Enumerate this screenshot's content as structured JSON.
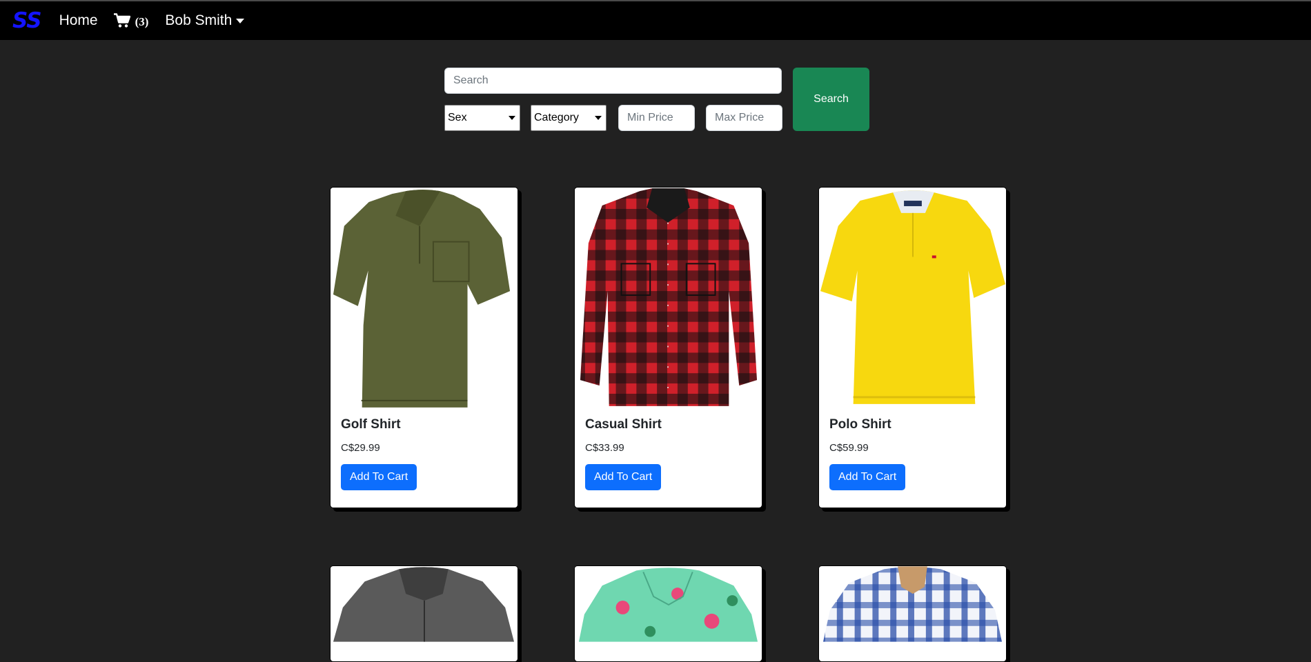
{
  "navbar": {
    "brand": "SS",
    "home_label": "Home",
    "cart_count": "(3)",
    "user_name": "Bob Smith"
  },
  "search": {
    "placeholder": "Search",
    "button_label": "Search",
    "sex_selected": "Sex",
    "category_selected": "Category",
    "min_price_placeholder": "Min Price",
    "max_price_placeholder": "Max Price"
  },
  "products": [
    {
      "title": "Golf Shirt",
      "price": "C$29.99",
      "button_label": "Add To Cart",
      "color": "#5b6236"
    },
    {
      "title": "Casual Shirt",
      "price": "C$33.99",
      "button_label": "Add To Cart",
      "color": "#d0202a"
    },
    {
      "title": "Polo Shirt",
      "price": "C$59.99",
      "button_label": "Add To Cart",
      "color": "#f7d80f"
    }
  ],
  "colors": {
    "background": "#212121",
    "navbar": "#000000",
    "brand": "#1414ff",
    "search_button": "#198754",
    "cart_button": "#0d6efd"
  }
}
